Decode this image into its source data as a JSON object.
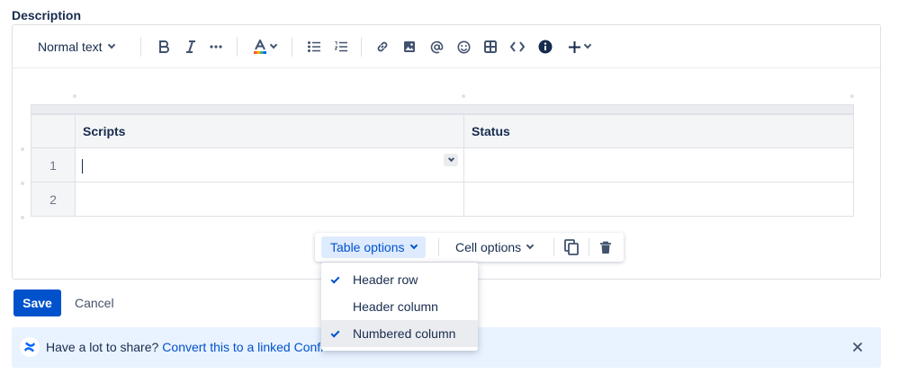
{
  "description_label": "Description",
  "toolbar": {
    "text_style": "Normal text",
    "icons": [
      "bold-icon",
      "italic-icon",
      "more-formatting-icon",
      "text-color-icon",
      "bullet-list-icon",
      "numbered-list-icon",
      "link-icon",
      "image-icon",
      "mention-icon",
      "emoji-icon",
      "table-icon",
      "code-icon",
      "info-icon",
      "insert-plus-icon"
    ]
  },
  "table": {
    "headers": [
      "Scripts",
      "Status"
    ],
    "row_numbers": [
      "1",
      "2"
    ]
  },
  "floating_toolbar": {
    "table_options": "Table options",
    "cell_options": "Cell options"
  },
  "dropdown": {
    "items": [
      {
        "label": "Header row",
        "checked": true
      },
      {
        "label": "Header column",
        "checked": false
      },
      {
        "label": "Numbered column",
        "checked": true
      }
    ]
  },
  "actions": {
    "save": "Save",
    "cancel": "Cancel"
  },
  "banner": {
    "text": "Have a lot to share?",
    "link": "Convert this to a linked Confl"
  },
  "colors": {
    "primary": "#0052cc",
    "banner_bg": "#e9f2ff",
    "text": "#172b4d"
  }
}
